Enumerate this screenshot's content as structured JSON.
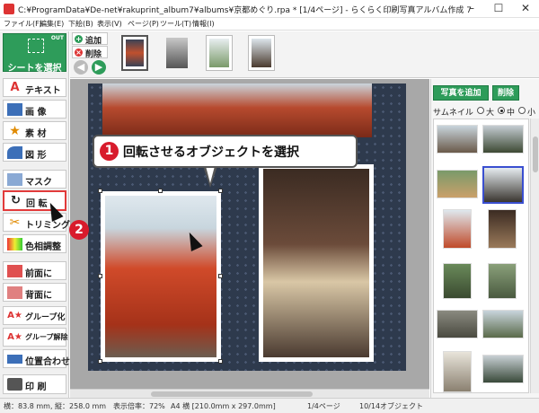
{
  "window": {
    "title": "C:¥ProgramData¥De-net¥rakuprint_album7¥albums¥京都めぐり.rpa * [1/4ページ] - らくらく印刷写真アルバム作成 7",
    "minimize": "–",
    "maximize": "☐",
    "close": "✕"
  },
  "menu": [
    "ファイル(F)",
    "編集(E)",
    "下絵(B)",
    "表示(V)",
    "ページ(P)",
    "ツール(T)",
    "情報(I)"
  ],
  "tools": {
    "select": {
      "label": "シートを選択",
      "badge": "OUT"
    },
    "text": "テキスト",
    "image": "画 像",
    "material": "素 材",
    "shape": "図 形",
    "mask": "マスク",
    "rotate": "回 転",
    "trim": "トリミング",
    "color_adjust": "色相調整",
    "front": "前面に",
    "back": "背面に",
    "group": "グループ化",
    "ungroup": "グループ解除",
    "align": "位置合わせ",
    "print": "印 刷"
  },
  "page_strip": {
    "add": "追加",
    "delete": "削除",
    "prev": "◀",
    "next": "▶"
  },
  "callout": {
    "step1_number": "1",
    "step1_text": "回転させるオブジェクトを選択",
    "step2_number": "2"
  },
  "right_panel": {
    "add_photo": "写真を追加",
    "delete": "削除",
    "thumbnail_label": "サムネイル",
    "size_options": [
      "大",
      "中",
      "小"
    ],
    "selected_size": "中"
  },
  "status": {
    "size": "横：83.8 mm, 縦：258.0 mm",
    "zoom": "表示倍率：72%",
    "paper": "A4 横 [210.0mm x 297.0mm]",
    "page": "1/4ページ",
    "objects": "10/14オブジェクト"
  },
  "colors": {
    "accent_green": "#2e9c5a",
    "highlight_red": "#e23b3b",
    "step_badge_red": "#d81b2c",
    "selection_blue": "#3a4fd0"
  }
}
